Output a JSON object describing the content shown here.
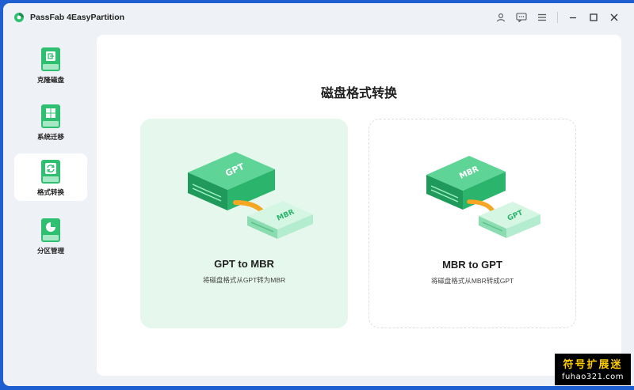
{
  "app": {
    "title": "PassFab 4EasyPartition"
  },
  "titlebar": {
    "icons": [
      "user-icon",
      "feedback-icon",
      "menu-icon",
      "minimize-icon",
      "maximize-icon",
      "close-icon"
    ]
  },
  "sidebar": {
    "items": [
      {
        "label": "克隆磁盘",
        "icon": "clone-disk-icon",
        "active": false
      },
      {
        "label": "系统迁移",
        "icon": "system-migrate-icon",
        "active": false
      },
      {
        "label": "格式转换",
        "icon": "format-convert-icon",
        "active": true
      },
      {
        "label": "分区管理",
        "icon": "partition-manage-icon",
        "active": false
      }
    ]
  },
  "main": {
    "title": "磁盘格式转换",
    "cards": [
      {
        "title": "GPT to MBR",
        "desc": "将磁盘格式从GPT转为MBR",
        "from_label": "GPT",
        "to_label": "MBR",
        "selected": true
      },
      {
        "title": "MBR to GPT",
        "desc": "将磁盘格式从MBR转成GPT",
        "from_label": "MBR",
        "to_label": "GPT",
        "selected": false
      }
    ]
  },
  "watermark": {
    "line1": "符号扩展迷",
    "line2": "fuhao321.com"
  },
  "colors": {
    "accent_green": "#2fbf71",
    "card_selected_bg": "#e6f8ee",
    "window_bg": "#eef1f5",
    "arrow_orange": "#f5a623"
  }
}
